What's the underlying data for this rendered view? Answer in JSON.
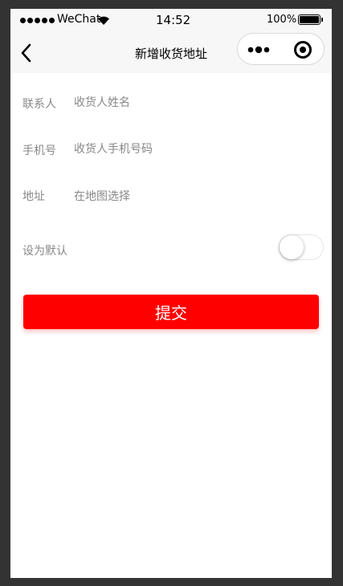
{
  "status_bar": {
    "carrier": "WeChat",
    "time": "14:52",
    "battery_percent": "100%",
    "battery_level": 1.0
  },
  "nav": {
    "title": "新增收货地址",
    "back_icon": "chevron-left-icon",
    "more_icon": "more-dots-icon",
    "close_icon": "target-close-icon"
  },
  "form": {
    "contact": {
      "label": "联系人",
      "placeholder": "收货人姓名",
      "value": ""
    },
    "phone": {
      "label": "手机号",
      "placeholder": "收货人手机号码",
      "value": ""
    },
    "address": {
      "label": "地址",
      "placeholder": "在地图选择"
    },
    "default": {
      "label": "设为默认",
      "checked": false
    }
  },
  "submit_label": "提交",
  "colors": {
    "accent": "#ff0000",
    "nav_bg": "#f7f7f7",
    "label_text": "#888888",
    "frame": "#333333"
  }
}
